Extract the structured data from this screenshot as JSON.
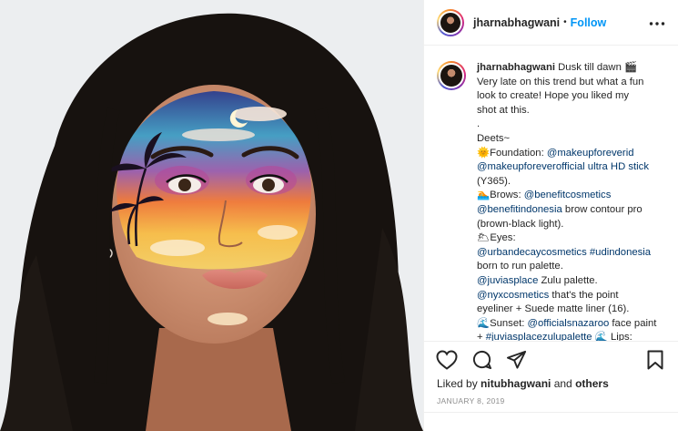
{
  "header": {
    "username": "jharnabhagwani",
    "separator": "•",
    "follow_label": "Follow",
    "more_icon": "more-horizontal-icon"
  },
  "caption": {
    "username": "jharnabhagwani",
    "lines": [
      " Dusk till dawn 🎬",
      "Very late on this trend but what a fun",
      "look to create! Hope you liked my",
      "shot at this.",
      ".",
      "Deets~",
      "🌞Foundation: @makeupforeverid",
      "@makeupforeverofficial ultra HD stick",
      "(Y365).",
      "🏊Brows: @benefitcosmetics",
      "@benefitindonesia brow contour pro",
      "(brown-black light).",
      "🌥Eyes:",
      "@urbandecaycosmetics #udindonesia",
      "born to run palette.",
      "@juviasplace Zulu palette.",
      "@nyxcosmetics that's the point",
      "eyeliner + Suede matte liner (16).",
      "🌊Sunset: @officialsnazaroo face paint",
      "+ #juviasplacezulupalette 🌊 Lips:"
    ]
  },
  "actions": {
    "like_icon": "heart-icon",
    "comment_icon": "comment-icon",
    "share_icon": "share-icon",
    "save_icon": "bookmark-icon"
  },
  "likes": {
    "prefix": "Liked by ",
    "user": "nitubhagwani",
    "middle": " and ",
    "others": "others"
  },
  "date": "JANUARY 8, 2019",
  "colors": {
    "link": "#00376b",
    "follow": "#0095f6",
    "muted": "#8e8e8e"
  }
}
